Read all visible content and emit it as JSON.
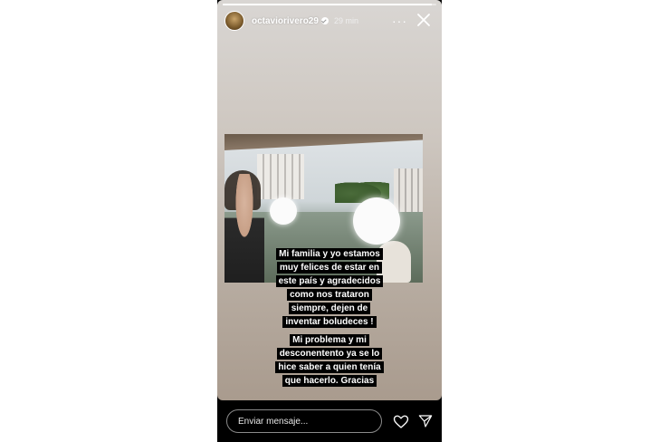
{
  "story": {
    "username": "octaviorivero29",
    "time_ago": "29 min",
    "more_icon": "ellipsis-icon",
    "close_icon": "close-icon",
    "progress": 0.98
  },
  "caption": {
    "block1": [
      "Mi familia y yo estamos",
      "muy felices de estar en",
      "este país y agradecidos",
      "como nos trataron",
      "siempre, dejen de",
      "inventar boludeces !"
    ],
    "block2": [
      "Mi problema y mi",
      "desconentento ya se lo",
      "hice saber a quien tenía",
      "que hacerlo. Gracias"
    ]
  },
  "footer": {
    "message_placeholder": "Enviar mensaje...",
    "like_icon": "heart-icon",
    "send_icon": "paper-plane-icon"
  },
  "colors": {
    "background": "#ffffff",
    "story_frame": "#000000",
    "caption_bg": "#000000",
    "text": "#ffffff"
  }
}
